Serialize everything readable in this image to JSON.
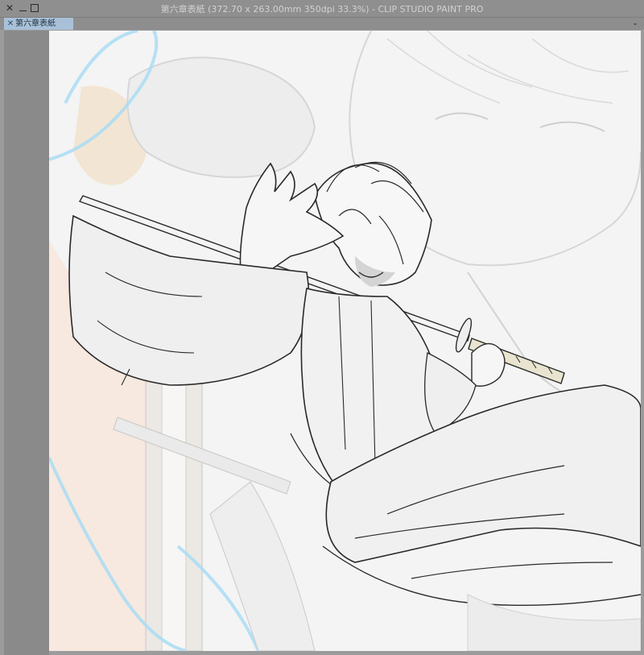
{
  "window": {
    "title": "第六章表紙 (372.70 x 263.00mm 350dpi 33.3%)  - CLIP STUDIO PAINT PRO",
    "controls": {
      "close_icon": "close-icon",
      "minimize_icon": "minimize-icon",
      "maximize_icon": "maximize-icon"
    }
  },
  "tabs": [
    {
      "label": "第六章表紙",
      "active": true
    }
  ],
  "tabbar": {
    "overflow_icon": "chevron-down-icon"
  },
  "colors": {
    "titlebar": "#8f8f8f",
    "title_text": "#d2d2d2",
    "tab_active": "#a9c1d8",
    "workspace": "#9b9b9b",
    "canvas_bg": "#f3f4f3",
    "guide_blue": "#a9dcf5"
  }
}
